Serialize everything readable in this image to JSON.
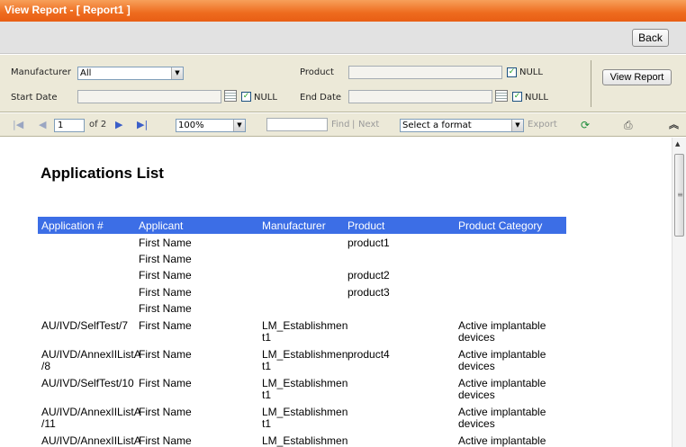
{
  "window": {
    "title": "View Report - [ Report1 ]"
  },
  "nav": {
    "back_label": "Back"
  },
  "params": {
    "manufacturer_label": "Manufacturer",
    "manufacturer_value": "All",
    "product_label": "Product",
    "product_value": "",
    "start_date_label": "Start Date",
    "start_date_value": "",
    "end_date_label": "End Date",
    "end_date_value": "",
    "null_label": "NULL",
    "view_report_label": "View Report"
  },
  "toolbar": {
    "current_page": "1",
    "page_of": "of 2",
    "zoom": "100%",
    "find_label": "Find",
    "separator": "|",
    "next_label": "Next",
    "format_placeholder": "Select a format",
    "export_label": "Export"
  },
  "report": {
    "title": "Applications List",
    "columns": [
      "Application #",
      "Applicant",
      "Manufacturer",
      "Product",
      "Product Category"
    ],
    "rows": [
      [
        "",
        "First Name",
        "",
        "product1",
        ""
      ],
      [
        "",
        "First Name",
        "",
        "",
        ""
      ],
      [
        "",
        "First Name",
        "",
        "product2",
        ""
      ],
      [
        "",
        "First Name",
        "",
        "product3",
        ""
      ],
      [
        "",
        "First Name",
        "",
        "",
        ""
      ],
      [
        "AU/IVD/SelfTest/7",
        "First Name",
        "LM_Establishmen\nt1",
        "",
        "Active implantable\ndevices"
      ],
      [
        "AU/IVD/AnnexIIListA\n/8",
        "First Name",
        "LM_Establishmen\nt1",
        "product4",
        "Active implantable\ndevices"
      ],
      [
        "AU/IVD/SelfTest/10",
        "First Name",
        "LM_Establishmen\nt1",
        "",
        "Active implantable\ndevices"
      ],
      [
        "AU/IVD/AnnexIIListA\n/11",
        "First Name",
        "LM_Establishmen\nt1",
        "",
        "Active implantable\ndevices"
      ],
      [
        "AU/IVD/AnnexIIListA",
        "First Name",
        "LM_Establishmen",
        "",
        "Active implantable"
      ]
    ]
  },
  "colors": {
    "title_bar": "#ee6b1e",
    "header_row": "#3c6ee6",
    "panel": "#ece9d8"
  }
}
